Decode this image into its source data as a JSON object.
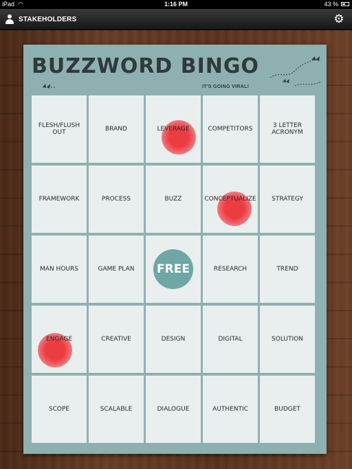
{
  "status_bar": {
    "carrier": "iPad",
    "time": "1:16 PM",
    "battery": "43 %"
  },
  "nav_bar": {
    "title": "STAKEHOLDERS",
    "left_icon": "person-icon",
    "right_icon": "gear-icon"
  },
  "card": {
    "title": "BUZZWORD BINGO",
    "tagline": "IT'S GOING VIRAL!",
    "background_color": "#8fb0b0",
    "cell_color": "#e9eeee",
    "mark_color": "#ee1c24"
  },
  "grid": {
    "rows": [
      [
        {
          "label": "FLESH/FLUSH OUT",
          "marked": false
        },
        {
          "label": "BRAND",
          "marked": false
        },
        {
          "label": "LEVERAGE",
          "marked": true
        },
        {
          "label": "COMPETITORS",
          "marked": false
        },
        {
          "label": "3 LETTER ACRONYM",
          "marked": false
        }
      ],
      [
        {
          "label": "FRAMEWORK",
          "marked": false
        },
        {
          "label": "PROCESS",
          "marked": false
        },
        {
          "label": "BUZZ",
          "marked": false
        },
        {
          "label": "CONCEPTUALIZE",
          "marked": true
        },
        {
          "label": "STRATEGY",
          "marked": false
        }
      ],
      [
        {
          "label": "MAN HOURS",
          "marked": false
        },
        {
          "label": "GAME PLAN",
          "marked": false
        },
        {
          "label": "FREE",
          "marked": false,
          "free": true
        },
        {
          "label": "RESEARCH",
          "marked": false
        },
        {
          "label": "TREND",
          "marked": false
        }
      ],
      [
        {
          "label": "ENGAGE",
          "marked": true
        },
        {
          "label": "CREATIVE",
          "marked": false
        },
        {
          "label": "DESIGN",
          "marked": false
        },
        {
          "label": "DIGITAL",
          "marked": false
        },
        {
          "label": "SOLUTION",
          "marked": false
        }
      ],
      [
        {
          "label": "SCOPE",
          "marked": false
        },
        {
          "label": "SCALABLE",
          "marked": false
        },
        {
          "label": "DIALOGUE",
          "marked": false
        },
        {
          "label": "AUTHENTIC",
          "marked": false
        },
        {
          "label": "BUDGET",
          "marked": false
        }
      ]
    ]
  }
}
